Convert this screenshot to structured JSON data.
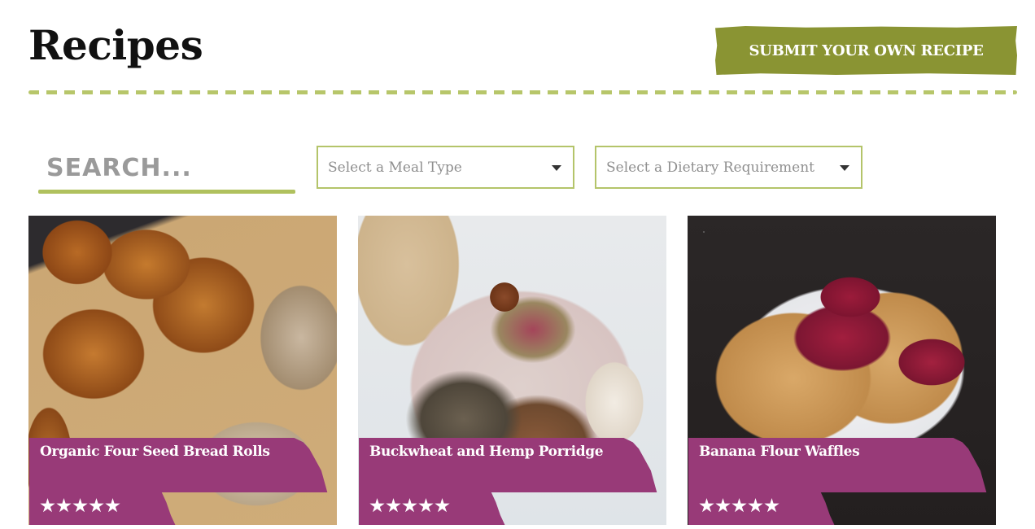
{
  "header": {
    "title": "Recipes",
    "submit_button_label": "SUBMIT YOUR OWN RECIPE"
  },
  "filters": {
    "search_placeholder": "SEARCH...",
    "search_value": "",
    "meal_type": {
      "selected": "Select a Meal Type"
    },
    "dietary_requirement": {
      "selected": "Select a Dietary Requirement"
    }
  },
  "recipes": [
    {
      "title": "Organic Four Seed Bread Rolls",
      "image": "bread-rolls-photo",
      "rating": 5,
      "rating_max": 5
    },
    {
      "title": "Buckwheat and Hemp Porridge",
      "image": "porridge-bowl-photo",
      "rating": 5,
      "rating_max": 5
    },
    {
      "title": "Banana Flour Waffles",
      "image": "waffles-photo",
      "rating": 5,
      "rating_max": 5
    }
  ],
  "colors": {
    "accent_green": "#8a9433",
    "divider_green": "#b7c66a",
    "card_band_purple": "#983a78",
    "title_text": "#111111"
  }
}
